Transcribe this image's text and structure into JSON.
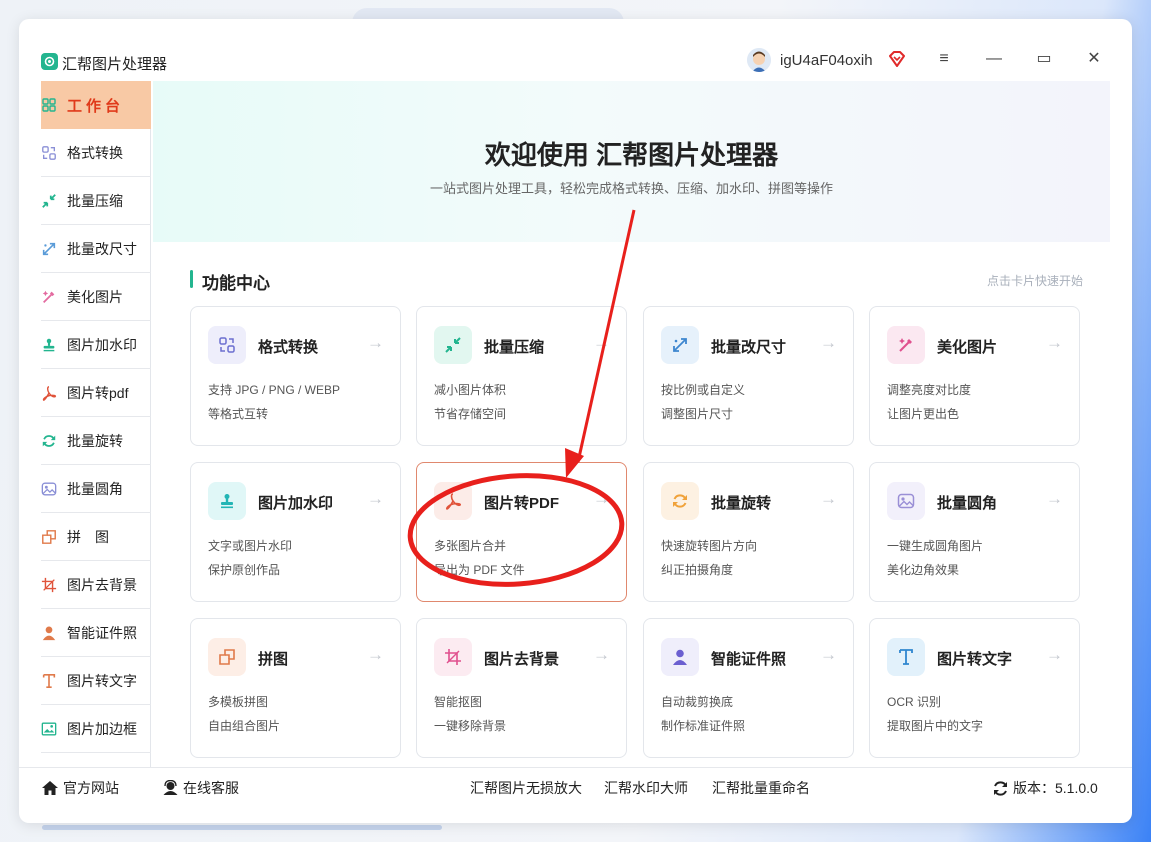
{
  "app": {
    "title": "汇帮图片处理器",
    "user_name": "igU4aF04oxih"
  },
  "window_controls": {
    "menu": "≡",
    "minimize": "—",
    "maximize": "▭",
    "close": "✕"
  },
  "sidebar": {
    "items": [
      {
        "label": "工作台",
        "icon": "grid-icon",
        "color": "#23b58f"
      },
      {
        "label": "格式转换",
        "icon": "convert-icon",
        "color": "#8a8fd6"
      },
      {
        "label": "批量压缩",
        "icon": "compress-icon",
        "color": "#23b58f"
      },
      {
        "label": "批量改尺寸",
        "icon": "resize-icon",
        "color": "#5a9bd8"
      },
      {
        "label": "美化图片",
        "icon": "beautify-icon",
        "color": "#e36ba0"
      },
      {
        "label": "图片加水印",
        "icon": "watermark-icon",
        "color": "#23b58f"
      },
      {
        "label": "图片转pdf",
        "icon": "pdf-icon",
        "color": "#e0533a"
      },
      {
        "label": "批量旋转",
        "icon": "rotate-icon",
        "color": "#23b58f"
      },
      {
        "label": "批量圆角",
        "icon": "round-corner-icon",
        "color": "#8a8fd6"
      },
      {
        "label": "拼　图",
        "icon": "collage-icon",
        "color": "#e07a4a"
      },
      {
        "label": "图片去背景",
        "icon": "crop-icon",
        "color": "#e0533a"
      },
      {
        "label": "智能证件照",
        "icon": "person-icon",
        "color": "#e07a4a"
      },
      {
        "label": "图片转文字",
        "icon": "text-icon",
        "color": "#e07a4a"
      },
      {
        "label": "图片加边框",
        "icon": "frame-icon",
        "color": "#23b58f"
      }
    ]
  },
  "hero": {
    "title": "欢迎使用 汇帮图片处理器",
    "subtitle": "一站式图片处理工具，轻松完成格式转换、压缩、加水印、拼图等操作"
  },
  "section": {
    "title": "功能中心",
    "hint": "点击卡片快速开始"
  },
  "cards": [
    {
      "title": "格式转换",
      "line1": "支持 JPG / PNG / WEBP",
      "line2": "等格式互转",
      "icon": "convert-icon",
      "bg": "#eeeefb",
      "color": "#6b6fd0"
    },
    {
      "title": "批量压缩",
      "line1": "减小图片体积",
      "line2": "节省存储空间",
      "icon": "compress-icon",
      "bg": "#e2f7f0",
      "color": "#23b58f"
    },
    {
      "title": "批量改尺寸",
      "line1": "按比例或自定义",
      "line2": "调整图片尺寸",
      "icon": "resize-icon",
      "bg": "#e6f1fb",
      "color": "#3d86cf"
    },
    {
      "title": "美化图片",
      "line1": "调整亮度对比度",
      "line2": "让图片更出色",
      "icon": "beautify-icon",
      "bg": "#fbe8f1",
      "color": "#e0508e"
    },
    {
      "title": "图片加水印",
      "line1": "文字或图片水印",
      "line2": "保护原创作品",
      "icon": "watermark-icon",
      "bg": "#e0f7f7",
      "color": "#23b5b5"
    },
    {
      "title": "图片转PDF",
      "line1": "多张图片合并",
      "line2": "导出为 PDF 文件",
      "icon": "pdf-icon",
      "bg": "#fcece8",
      "color": "#e0533a"
    },
    {
      "title": "批量旋转",
      "line1": "快速旋转图片方向",
      "line2": "纠正拍摄角度",
      "icon": "rotate-icon",
      "bg": "#fdf1e2",
      "color": "#f0a23a"
    },
    {
      "title": "批量圆角",
      "line1": "一键生成圆角图片",
      "line2": "美化边角效果",
      "icon": "round-corner-icon",
      "bg": "#f2f0fb",
      "color": "#9a8fd6"
    },
    {
      "title": "拼图",
      "line1": "多模板拼图",
      "line2": "自由组合图片",
      "icon": "collage-icon",
      "bg": "#fdeee6",
      "color": "#e07a4a"
    },
    {
      "title": "图片去背景",
      "line1": "智能抠图",
      "line2": "一键移除背景",
      "icon": "crop-icon",
      "bg": "#fcebf1",
      "color": "#e0508e"
    },
    {
      "title": "智能证件照",
      "line1": "自动裁剪换底",
      "line2": "制作标准证件照",
      "icon": "person-icon",
      "bg": "#efeefb",
      "color": "#6b5fd0"
    },
    {
      "title": "图片转文字",
      "line1": "OCR 识别",
      "line2": "提取图片中的文字",
      "icon": "text-icon",
      "bg": "#e2f1fb",
      "color": "#2f86cf"
    }
  ],
  "card_arrow": "→",
  "footer": {
    "website": "官方网站",
    "support": "在线客服",
    "link1": "汇帮图片无损放大",
    "link2": "汇帮水印大师",
    "link3": "汇帮批量重命名",
    "version": "版本：5.1.0.0"
  }
}
